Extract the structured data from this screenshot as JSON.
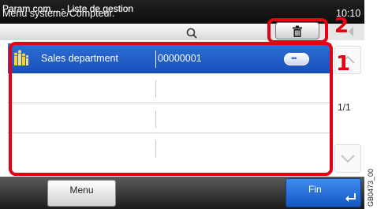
{
  "header": {
    "title": "Menu système/Compteur.",
    "clock": "10:10",
    "breadcrumb": "Param com... - Liste de gestion"
  },
  "toolbar": {
    "search_icon": "search-icon",
    "delete_icon": "trash-icon"
  },
  "callouts": {
    "list": "1",
    "delete": "2"
  },
  "list": {
    "rows": [
      {
        "name": "Sales department",
        "number": "00000001",
        "selected": true,
        "icon": "group-icon",
        "detail_icon": "ellipsis-icon"
      },
      {
        "name": "",
        "number": "",
        "selected": false
      },
      {
        "name": "",
        "number": "",
        "selected": false
      },
      {
        "name": "",
        "number": "",
        "selected": false
      }
    ]
  },
  "pagination": {
    "indicator": "1/1",
    "up_icon": "chevron-up-icon",
    "down_icon": "chevron-down-icon"
  },
  "footer": {
    "menu_label": "Menu",
    "fin_label": "Fin",
    "enter_icon": "enter-arrow-icon"
  },
  "image_id": "GB0473_00",
  "colors": {
    "accent": "#e60012",
    "selection": "#1f5ec4",
    "primary_button": "#2a6fe0",
    "titlebar": "#111111"
  }
}
